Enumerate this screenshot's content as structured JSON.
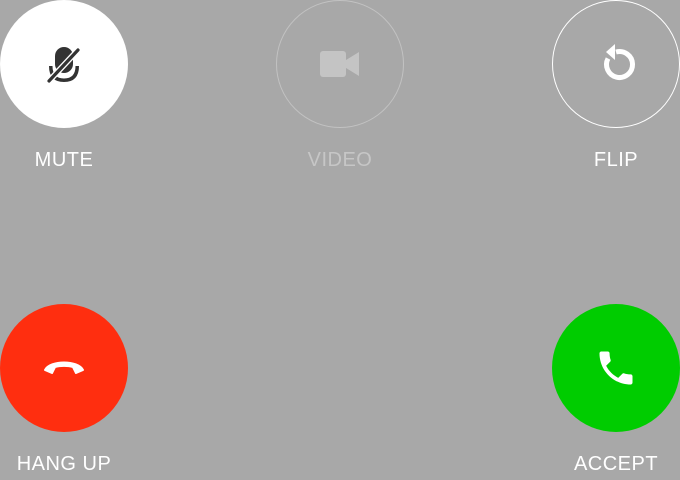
{
  "controls": {
    "mute": {
      "label": "MUTE",
      "icon": "mic-off-icon",
      "state": "active"
    },
    "video": {
      "label": "VIDEO",
      "icon": "video-camera-icon",
      "state": "disabled"
    },
    "flip": {
      "label": "FLIP",
      "icon": "flip-camera-icon",
      "state": "normal"
    },
    "hangup": {
      "label": "HANG UP",
      "icon": "hang-up-icon",
      "state": "normal"
    },
    "accept": {
      "label": "ACCEPT",
      "icon": "phone-icon",
      "state": "normal"
    }
  },
  "colors": {
    "background": "#a8a8a8",
    "mute_fill": "#ffffff",
    "mute_icon": "#333333",
    "disabled": "#c2c2c2",
    "hangup": "#ff2e0f",
    "accept": "#00cc00",
    "text": "#ffffff"
  }
}
